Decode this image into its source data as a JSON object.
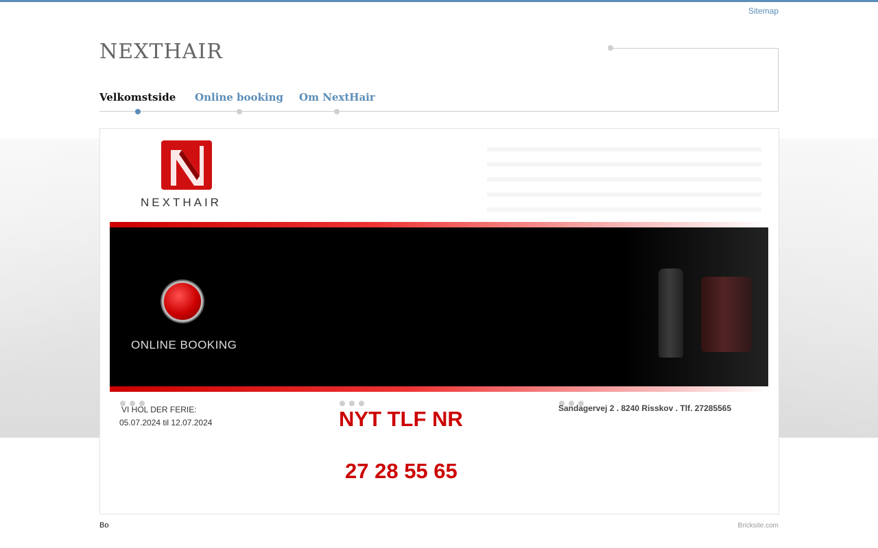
{
  "top_nav": {
    "sitemap_label": "Sitemap"
  },
  "header": {
    "brand": "NEXTHAIR"
  },
  "nav": {
    "items": [
      {
        "label": "Velkomstside",
        "active": true
      },
      {
        "label": "Online booking",
        "active": false
      },
      {
        "label": "Om NextHair",
        "active": false
      }
    ]
  },
  "banner": {
    "logo_text": "NEXTHAIR",
    "booking_label": "ONLINE BOOKING"
  },
  "columns": {
    "col1": {
      "line1": "VI HOL DER FERIE:",
      "line2": "05.07.2024 til 12.07.2024"
    },
    "col2": {
      "title": "NYT TLF NR",
      "phone": "27 28 55 65"
    },
    "col3": {
      "address": "Sandagervej 2 . 8240 Risskov . Tlf. 27285565"
    }
  },
  "footer": {
    "left_text": "Bo",
    "credit": "Bricksite.com"
  },
  "colors": {
    "accent": "#5b8db8",
    "highlight_red": "#cc0000",
    "banner_black": "#000000"
  },
  "icons": [
    "nexthair-logo-icon",
    "booking-button-icon"
  ]
}
